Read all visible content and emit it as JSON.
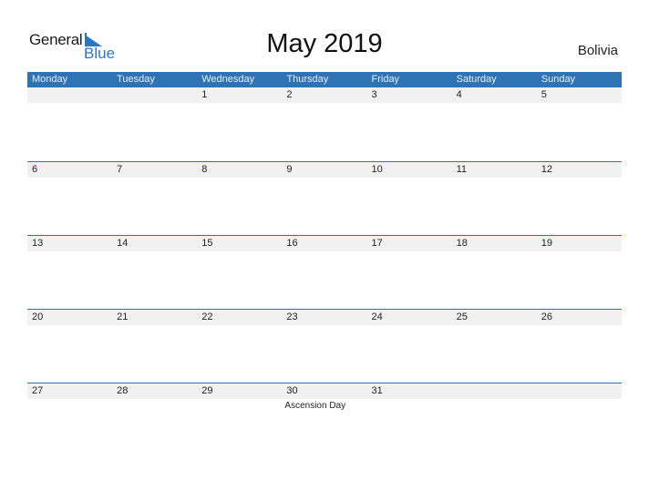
{
  "logo": {
    "line1": "General",
    "line2": "Blue"
  },
  "title": "May 2019",
  "country": "Bolivia",
  "colors": {
    "accent": "#2e74b5",
    "row_bg": "#f1f1f1",
    "logo_blue": "#2878c8"
  },
  "weekdays": [
    "Monday",
    "Tuesday",
    "Wednesday",
    "Thursday",
    "Friday",
    "Saturday",
    "Sunday"
  ],
  "weeks": [
    [
      "",
      "",
      "1",
      "2",
      "3",
      "4",
      "5"
    ],
    [
      "6",
      "7",
      "8",
      "9",
      "10",
      "11",
      "12"
    ],
    [
      "13",
      "14",
      "15",
      "16",
      "17",
      "18",
      "19"
    ],
    [
      "20",
      "21",
      "22",
      "23",
      "24",
      "25",
      "26"
    ],
    [
      "27",
      "28",
      "29",
      "30",
      "31",
      "",
      ""
    ]
  ],
  "holidays": [
    {
      "day": "30",
      "name": "Ascension Day"
    }
  ]
}
